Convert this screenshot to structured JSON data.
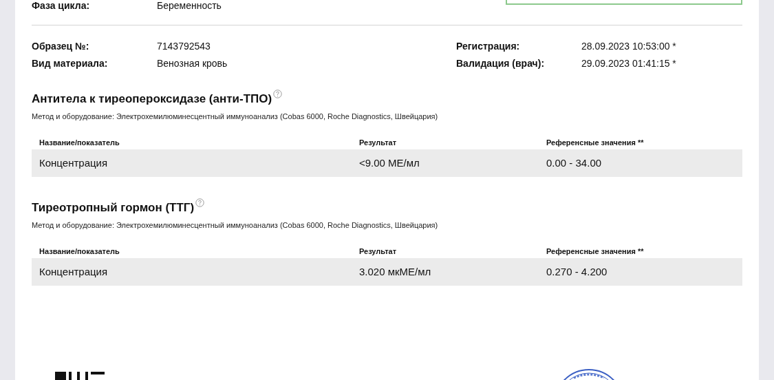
{
  "header": {
    "cycle_phase": {
      "label": "Фаза цикла:",
      "value": "Беременность"
    }
  },
  "sample": {
    "left": [
      {
        "label": "Образец №:",
        "value": "7143792543"
      },
      {
        "label": "Вид материала:",
        "value": "Венозная кровь"
      }
    ],
    "right": [
      {
        "label": "Регистрация:",
        "value": "28.09.2023 10:53:00 *"
      },
      {
        "label": "Валидация (врач):",
        "value": "29.09.2023 01:41:15 *"
      }
    ]
  },
  "tests": [
    {
      "title": "Антитела к тиреопероксидазе (анти-ТПО)",
      "method": "Метод и оборудование: Электрохемилюминесцентный иммуноанализ (Cobas 6000, Roche Diagnostics, Швейцария)",
      "columns": [
        "Название/показатель",
        "Результат",
        "Референсные значения **"
      ],
      "rows": [
        [
          "Концентрация",
          "<9.00 МЕ/мл",
          "0.00 - 34.00"
        ]
      ]
    },
    {
      "title": "Тиреотропный гормон (ТТГ)",
      "method": "Метод и оборудование: Электрохемилюминесцентный иммуноанализ (Cobas 6000, Roche Diagnostics, Швейцария)",
      "columns": [
        "Название/показатель",
        "Результат",
        "Референсные значения **"
      ],
      "rows": [
        [
          "Концентрация",
          "3.020 мкМЕ/мл",
          "0.270 - 4.200"
        ]
      ]
    }
  ]
}
